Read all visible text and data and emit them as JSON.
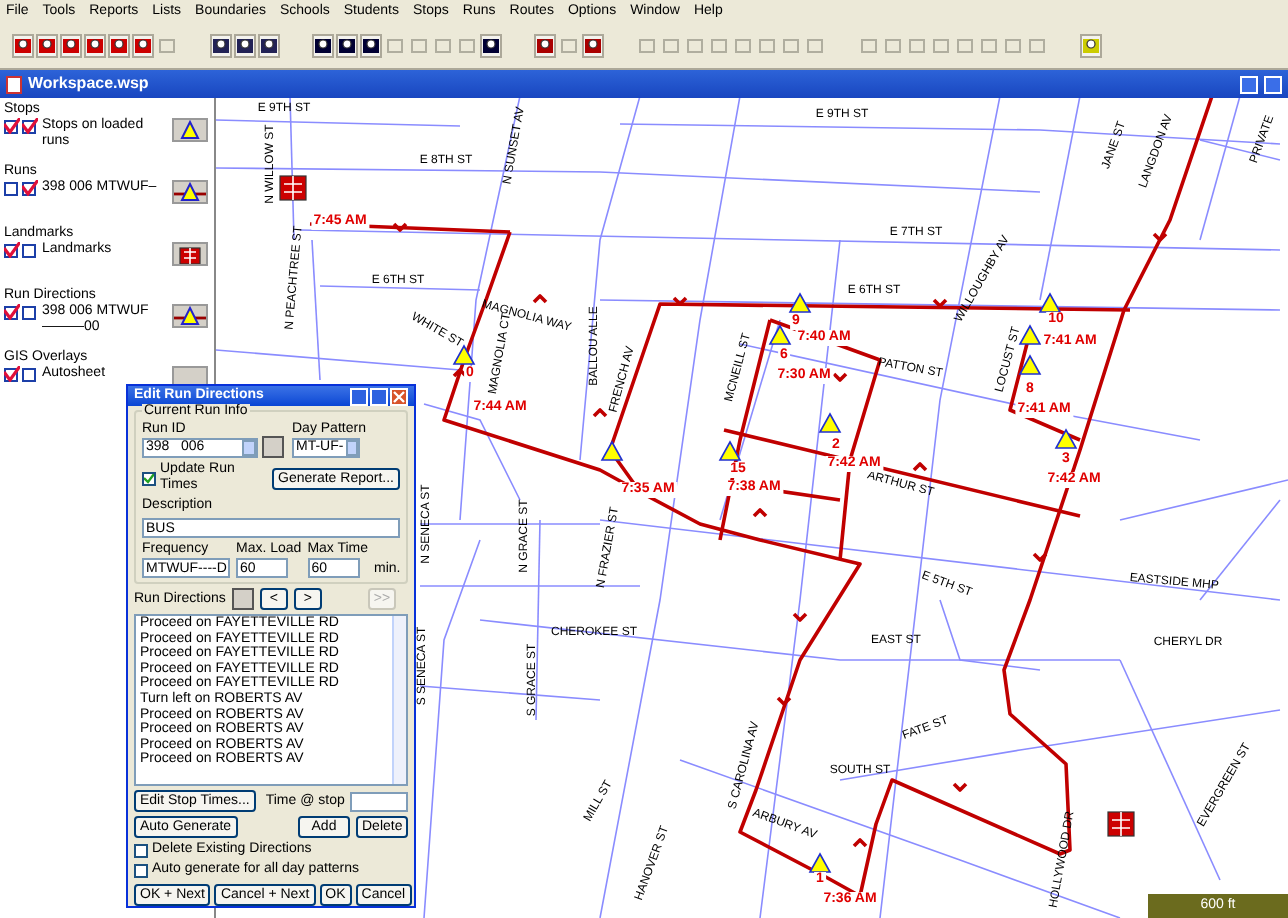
{
  "menu": [
    "File",
    "Tools",
    "Reports",
    "Lists",
    "Boundaries",
    "Schools",
    "Students",
    "Stops",
    "Runs",
    "Routes",
    "Options",
    "Window",
    "Help"
  ],
  "toolbar": [
    [
      {
        "disabled": false
      },
      {
        "disabled": false
      },
      {
        "disabled": false
      },
      {
        "disabled": false
      },
      {
        "disabled": false
      },
      {
        "disabled": false
      },
      {
        "disabled": true
      }
    ],
    [
      {
        "disabled": false
      },
      {
        "disabled": false
      },
      {
        "disabled": false
      }
    ],
    [
      {
        "disabled": false
      },
      {
        "disabled": false
      },
      {
        "disabled": false
      },
      {
        "disabled": true
      },
      {
        "disabled": true
      },
      {
        "disabled": true
      },
      {
        "disabled": true
      },
      {
        "disabled": false
      }
    ],
    [
      {
        "disabled": false
      },
      {
        "disabled": true
      },
      {
        "disabled": false
      }
    ],
    [
      {
        "disabled": true
      },
      {
        "disabled": true
      },
      {
        "disabled": true
      },
      {
        "disabled": true
      },
      {
        "disabled": true
      },
      {
        "disabled": true
      },
      {
        "disabled": true
      },
      {
        "disabled": true
      }
    ],
    [
      {
        "disabled": true
      },
      {
        "disabled": true
      },
      {
        "disabled": true
      },
      {
        "disabled": true
      },
      {
        "disabled": true
      },
      {
        "disabled": true
      },
      {
        "disabled": true
      },
      {
        "disabled": true
      }
    ],
    [
      {
        "disabled": false
      }
    ]
  ],
  "window": {
    "title": "Workspace.wsp"
  },
  "legend": [
    {
      "heading": "Stops",
      "label": "Stops on loaded runs",
      "checks": [
        true,
        true
      ],
      "kind": "stop"
    },
    {
      "heading": "Runs",
      "label": "398 006 MTWUF–",
      "checks": [
        false,
        true
      ],
      "kind": "run"
    },
    {
      "heading": "Landmarks",
      "label": "Landmarks",
      "checks": [
        true,
        false
      ],
      "kind": "school"
    },
    {
      "heading": "Run Directions",
      "label": "398 006 MTWUF———00",
      "checks": [
        true,
        false
      ],
      "kind": "run"
    },
    {
      "heading": "GIS Overlays",
      "label": "Autosheet",
      "checks": [
        true,
        false
      ],
      "kind": "blank"
    }
  ],
  "street_labels": [
    "E 9TH ST",
    "E 9TH ST",
    "E 8TH ST",
    "E 7TH ST",
    "E 6TH ST",
    "E 6TH ST",
    "PATTON ST",
    "ARTHUR ST",
    "E 5TH ST",
    "EASTSIDE MHP",
    "CHERYL DR",
    "CHEROKEE ST",
    "EAST ST",
    "SOUTH ST",
    "FATE ST",
    "ARBURY AV",
    "N WILLOW ST",
    "N PEACHTREE ST",
    "N SUNSET AV",
    "MAGNOLIA WAY",
    "WHITE ST",
    "MAGNOLIA CT",
    "BALLOU ALLE",
    "FRENCH AV",
    "MCNEILL ST",
    "WILLOUGHBY AV",
    "LOCUST ST",
    "LANGDON AV",
    "JANE ST",
    "PRIVATE",
    "N SENECA ST",
    "N GRACE ST",
    "N FRAZIER ST",
    "S SENECA ST",
    "S GRACE ST",
    "S CAROLINA AV",
    "MILL ST",
    "HANOVER ST",
    "HOLLYWOOD DR",
    "EVERGREEN ST"
  ],
  "stop_labels": [
    "9",
    "10",
    "7:41 AM",
    "0",
    "7:44 AM",
    "6",
    "7:40 AM",
    "7:30 AM",
    "8",
    "7:41 AM",
    "2",
    "7:42 AM",
    "3",
    "7:42 AM",
    "15",
    "7:38 AM",
    "7:35 AM",
    "1",
    "7:36 AM",
    "7:45 AM"
  ],
  "scale": "600 ft",
  "dialog": {
    "title": "Edit Run Directions",
    "group": "Current Run Info",
    "run_id": {
      "label": "Run ID",
      "value": "398   006"
    },
    "day_pattern": {
      "label": "Day Pattern",
      "value": "MT-UF-"
    },
    "update_times": {
      "label": "Update Run Times",
      "checked": true
    },
    "generate": "Generate Report...",
    "description": {
      "label": "Description",
      "value": "BUS"
    },
    "frequency": {
      "label": "Frequency",
      "value": "MTWUF----D"
    },
    "max_load": {
      "label": "Max. Load",
      "value": "60"
    },
    "max_time": {
      "label": "Max Time",
      "value": "60"
    },
    "unit": "min.",
    "directions_label": "Run Directions",
    "nav": [
      {
        "label": "<",
        "disabled": false
      },
      {
        "label": ">",
        "disabled": false
      },
      {
        "label": ">>",
        "disabled": true
      }
    ],
    "directions": [
      "Proceed on FAYETTEVILLE RD",
      "Proceed on FAYETTEVILLE RD",
      "Proceed on FAYETTEVILLE RD",
      "Proceed on FAYETTEVILLE RD",
      "Proceed on FAYETTEVILLE RD",
      "Turn left on ROBERTS AV",
      "Proceed on ROBERTS AV",
      "Proceed on ROBERTS AV",
      "Proceed on ROBERTS AV",
      "Proceed on ROBERTS AV"
    ],
    "edit_stop_times": "Edit Stop Times...",
    "time_at_stop": "Time @ stop",
    "auto_generate": "Auto Generate",
    "add": "Add",
    "delete": "Delete",
    "options": [
      {
        "label": "Delete Existing Directions",
        "checked": false
      },
      {
        "label": "Auto generate for all day patterns",
        "checked": false
      }
    ],
    "buttons": [
      "OK + Next",
      "Cancel + Next",
      "OK",
      "Cancel"
    ]
  }
}
